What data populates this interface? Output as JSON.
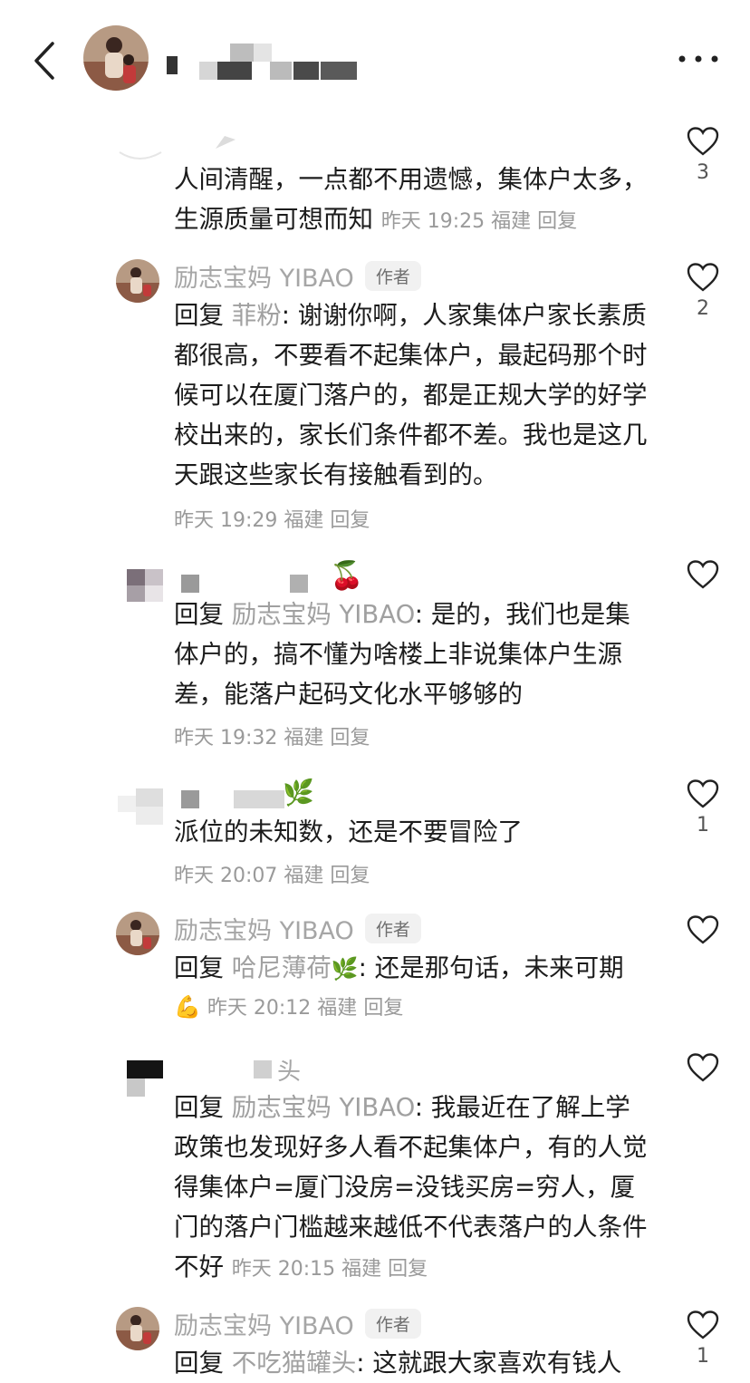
{
  "header": {
    "back_icon": "chevron-left-icon",
    "more_icon": "more-horizontal-icon"
  },
  "comments": [
    {
      "text": "人间清醒，一点都不用遗憾，集体户太多，生源质量可想而知",
      "time": "昨天 19:25",
      "location": "福建",
      "reply_label": "回复",
      "likes": "3"
    },
    {
      "name": "励志宝妈 YIBAO",
      "tag": "作者",
      "reply_prefix": "回复",
      "mention": "菲粉",
      "text": ": 谢谢你啊，人家集体户家长素质都很高，不要看不起集体户，最起码那个时候可以在厦门落户的，都是正规大学的好学校出来的，家长们条件都不差。我也是这几天跟这些家长有接触看到的。",
      "time": "昨天 19:29",
      "location": "福建",
      "reply_label": "回复",
      "likes": "2"
    },
    {
      "name_emoji": "🍒",
      "reply_prefix": "回复",
      "mention": "励志宝妈 YIBAO",
      "text": ": 是的，我们也是集体户的，搞不懂为啥楼上非说集体户生源差，能落户起码文化水平够够的",
      "time": "昨天 19:32",
      "location": "福建",
      "reply_label": "回复",
      "likes": ""
    },
    {
      "name_emoji": "🌿",
      "text": "派位的未知数，还是不要冒险了",
      "time": "昨天 20:07",
      "location": "福建",
      "reply_label": "回复",
      "likes": "1"
    },
    {
      "name": "励志宝妈 YIBAO",
      "tag": "作者",
      "reply_prefix": "回复",
      "mention": "哈尼薄荷",
      "mention_emoji": "🌿",
      "text": ": 还是那句话，未来可期",
      "trail_emoji": "💪",
      "time": "昨天 20:12",
      "location": "福建",
      "reply_label": "回复",
      "likes": ""
    },
    {
      "name_visible": "头",
      "reply_prefix": "回复",
      "mention": "励志宝妈 YIBAO",
      "text": ": 我最近在了解上学政策也发现好多人看不起集体户，有的人觉得集体户=厦门没房=没钱买房=穷人，厦门的落户门槛越来越低不代表落户的人条件不好",
      "time": "昨天 20:15",
      "location": "福建",
      "reply_label": "回复",
      "likes": ""
    },
    {
      "name": "励志宝妈 YIBAO",
      "tag": "作者",
      "reply_prefix": "回复",
      "mention": "不吃猫罐头",
      "text": ": 这就跟大家喜欢有钱人",
      "likes": "1"
    }
  ],
  "colors": {
    "text": "#1c1c1c",
    "muted": "#9a9a9a",
    "name": "#a6a6a6",
    "tag_bg": "#f1f1f1"
  }
}
